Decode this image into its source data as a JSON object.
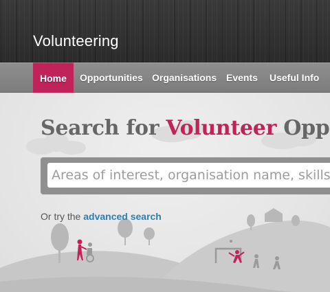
{
  "header": {
    "site_title": "Volunteering"
  },
  "nav": {
    "items": [
      {
        "label": "Home"
      },
      {
        "label": "Opportunities"
      },
      {
        "label": "Organisations"
      },
      {
        "label": "Events"
      },
      {
        "label": "Useful Info"
      }
    ]
  },
  "hero": {
    "headline_part1": "Search for ",
    "headline_accent": "Volunteer",
    "headline_part2": " Opportunities",
    "search_placeholder": "Areas of interest, organisation name, skills",
    "try_prefix": "Or try the ",
    "advanced_link": "advanced search"
  },
  "colors": {
    "accent": "#c0235a",
    "link": "#2a7fb0",
    "nav_bg": "#868686",
    "header_bg": "#333333"
  }
}
